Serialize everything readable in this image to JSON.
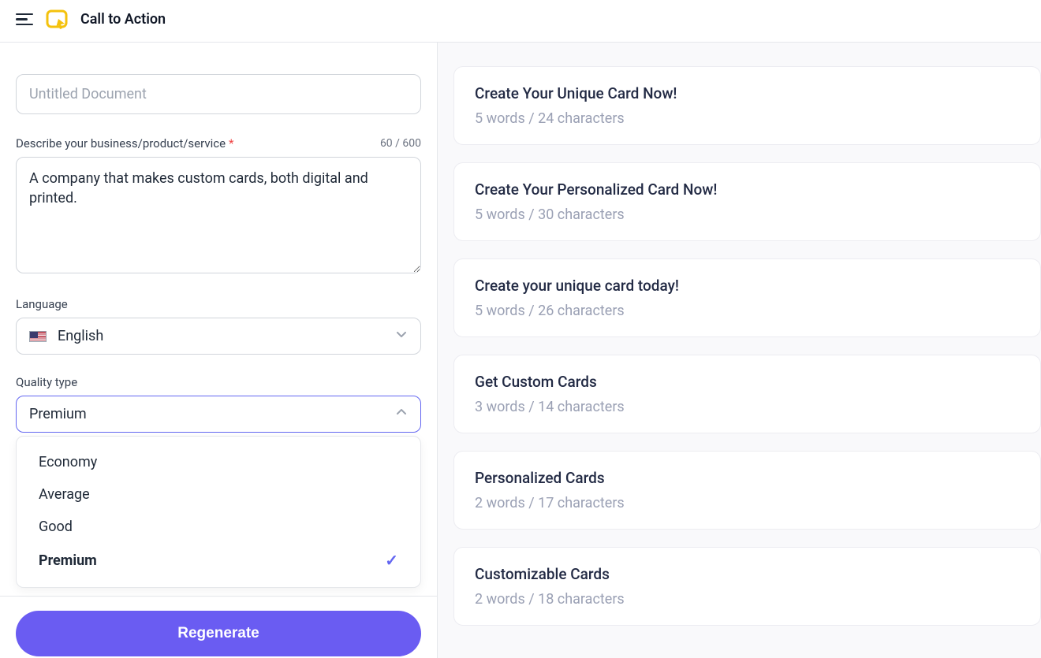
{
  "header": {
    "title": "Call to Action"
  },
  "form": {
    "doc_placeholder": "Untitled Document",
    "doc_value": "",
    "describe_label": "Describe your business/product/service",
    "counter": "60 / 600",
    "describe_value": "A company that makes custom cards, both digital and printed.",
    "language_label": "Language",
    "language_value": "English",
    "quality_label": "Quality type",
    "quality_value": "Premium",
    "quality_options": [
      "Economy",
      "Average",
      "Good",
      "Premium"
    ],
    "regenerate_label": "Regenerate"
  },
  "results": [
    {
      "title": "Create Your Unique Card Now!",
      "meta": "5 words / 24 characters"
    },
    {
      "title": "Create Your Personalized Card Now!",
      "meta": "5 words / 30 characters"
    },
    {
      "title": "Create your unique card today!",
      "meta": "5 words / 26 characters"
    },
    {
      "title": "Get Custom Cards",
      "meta": "3 words / 14 characters"
    },
    {
      "title": "Personalized Cards",
      "meta": "2 words / 17 characters"
    },
    {
      "title": "Customizable Cards",
      "meta": "2 words / 18 characters"
    }
  ]
}
